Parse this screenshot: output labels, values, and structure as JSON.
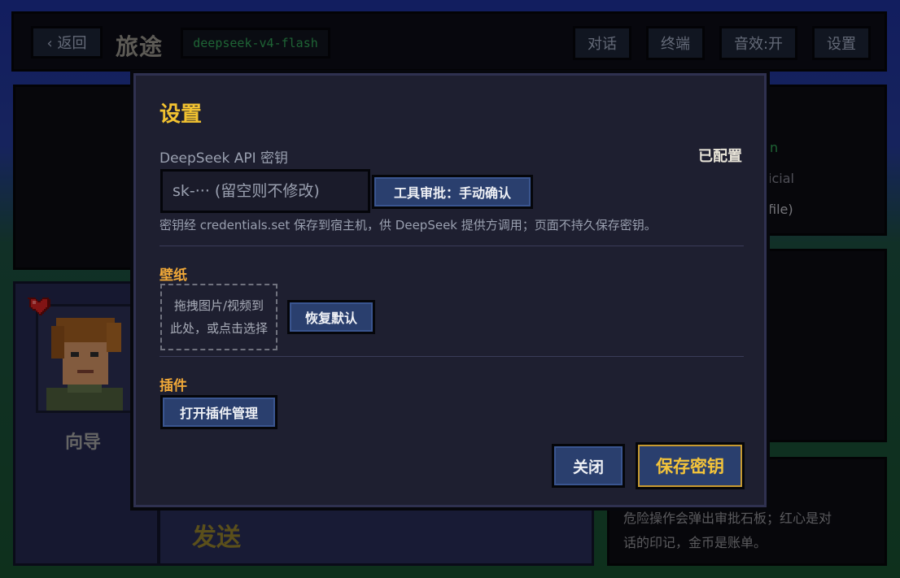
{
  "topbar": {
    "back_label": "‹ 返回",
    "title": "旅途",
    "model": "deepseek-v4-flash",
    "buttons": {
      "chat": "对话",
      "terminal": "终端",
      "sound": "音效:开",
      "settings": "设置"
    }
  },
  "background": {
    "side_fragment_1": "n",
    "side_fragment_2": "icial",
    "side_fragment_3": "file)",
    "guide_name": "向导",
    "send_label": "发送",
    "note_line1": "危险操作会弹出审批石板；红心是对",
    "note_line2": "话的印记，金币是账单。"
  },
  "settings": {
    "title": "设置",
    "api_key_label": "DeepSeek API 密钥",
    "api_status": "已配置",
    "api_key_value": "",
    "api_key_placeholder": "sk-··· (留空则不修改)",
    "approval_button": "工具审批：手动确认",
    "hint": "密钥经 credentials.set 保存到宿主机，供 DeepSeek 提供方调用；页面不持久保存密钥。",
    "wallpaper": {
      "title": "壁纸",
      "dropzone_line1": "拖拽图片/视频到",
      "dropzone_line2": "此处，或点击选择",
      "reset_button": "恢复默认"
    },
    "plugins": {
      "title": "插件",
      "manage_button": "打开插件管理"
    },
    "close_button": "关闭",
    "save_button": "保存密钥"
  },
  "colors": {
    "accent_title": "#f2c230",
    "section_title": "#f0a838",
    "button_bg": "#2a3f6e",
    "model_tag_text": "#2f9a52"
  }
}
